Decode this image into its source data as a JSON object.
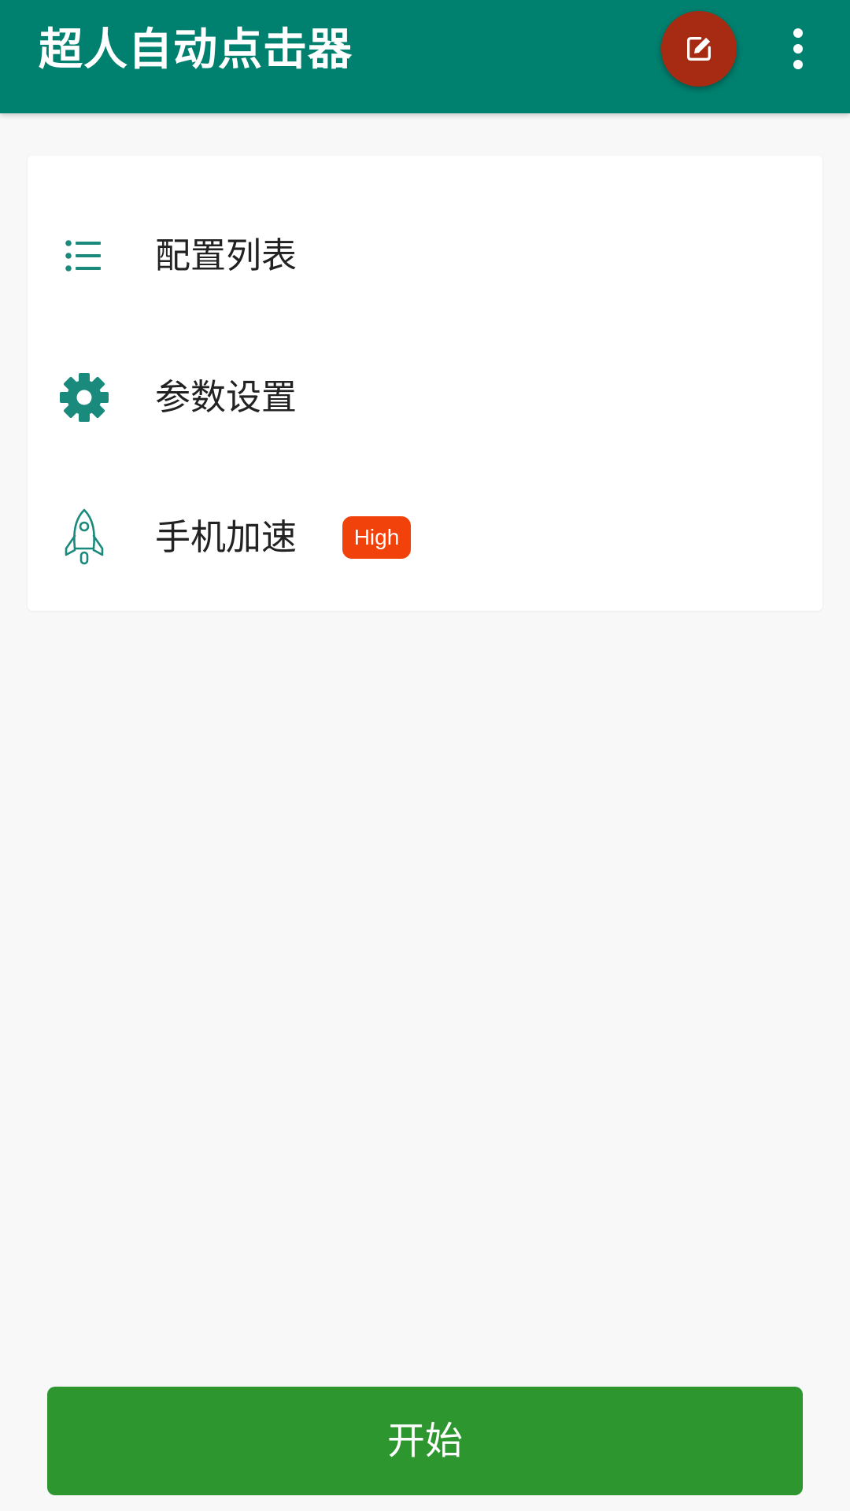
{
  "app_bar": {
    "title": "超人自动点击器",
    "background_color": "#00806f",
    "edit_button": {
      "icon": "edit-icon",
      "color": "#a62b12"
    },
    "more_button": {
      "icon": "more-vert-icon"
    }
  },
  "menu": {
    "items": [
      {
        "label": "配置列表",
        "icon": "list-icon"
      },
      {
        "label": "参数设置",
        "icon": "gear-icon"
      },
      {
        "label": "手机加速",
        "icon": "rocket-icon",
        "badge": "High"
      }
    ],
    "icon_color": "#1a8a7c",
    "badge_color": "#f0420a"
  },
  "start_button": {
    "label": "开始",
    "color": "#2e962f"
  }
}
